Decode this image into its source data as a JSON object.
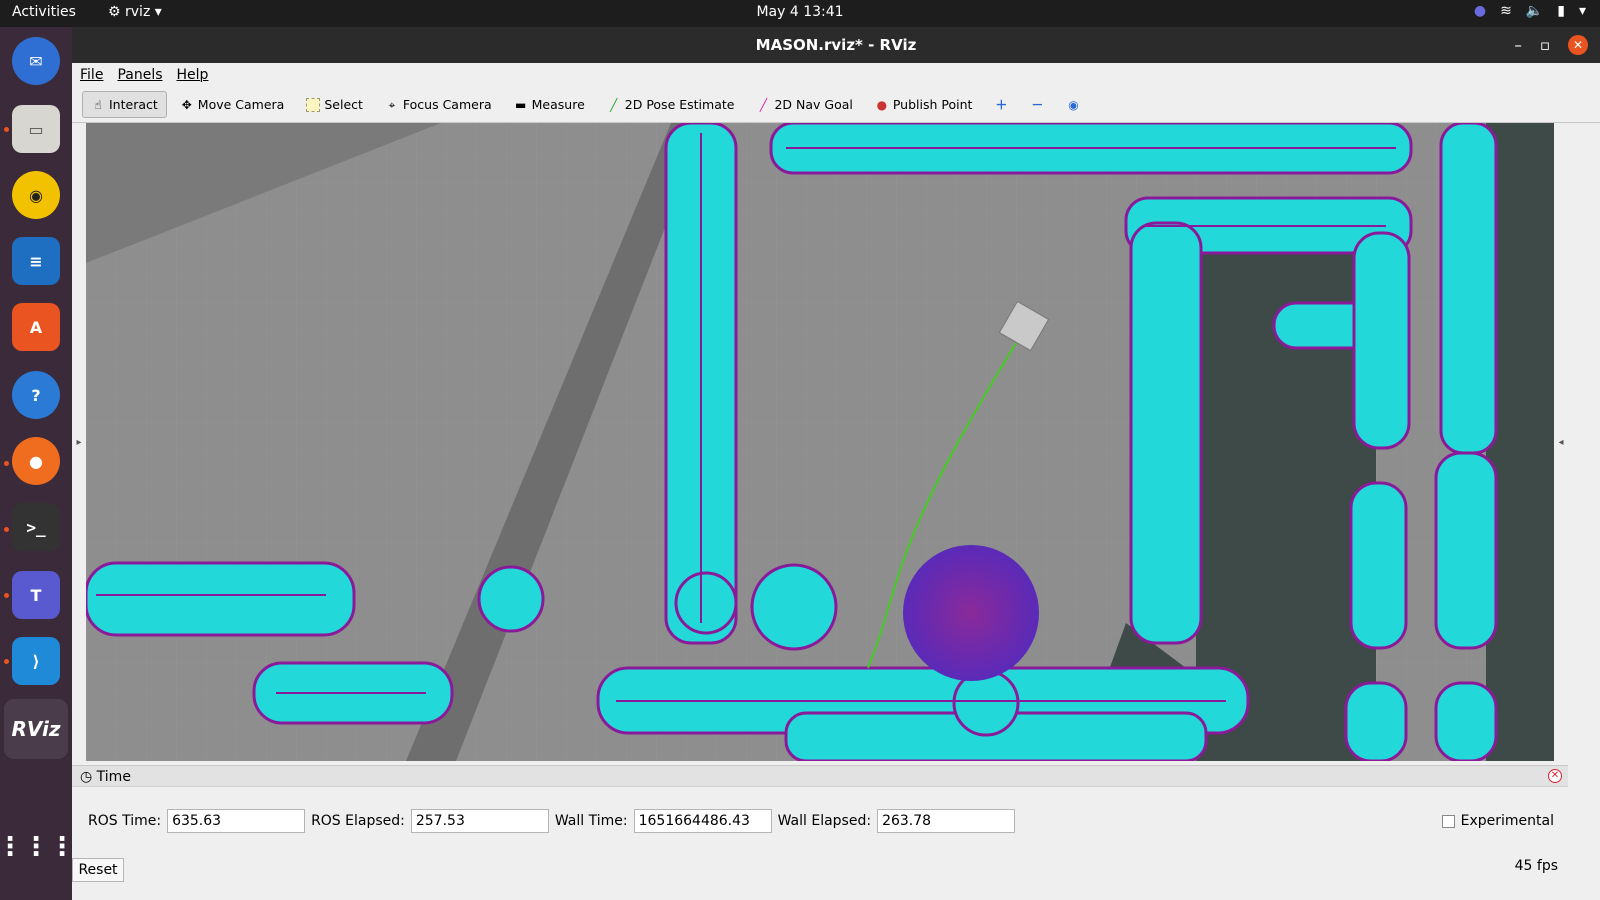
{
  "topbar": {
    "activities": "Activities",
    "app_name": "rviz",
    "clock": "May 4  13:41"
  },
  "dock": {
    "items": [
      "thunderbird",
      "files",
      "rhythmbox",
      "libreoffice-writer",
      "ubuntu-software",
      "help",
      "firefox",
      "terminal",
      "teams",
      "vscode",
      "rviz",
      "show-apps"
    ],
    "rviz_label": "RViz"
  },
  "window": {
    "title": "MASON.rviz* - RViz"
  },
  "menu": {
    "file": "File",
    "panels": "Panels",
    "help": "Help"
  },
  "toolbar": {
    "interact": "Interact",
    "move_camera": "Move Camera",
    "select": "Select",
    "focus_camera": "Focus Camera",
    "measure": "Measure",
    "pose_estimate": "2D Pose Estimate",
    "nav_goal": "2D Nav Goal",
    "publish_point": "Publish Point"
  },
  "time_panel": {
    "title": "Time",
    "ros_time_label": "ROS Time:",
    "ros_time": "635.63",
    "ros_elapsed_label": "ROS Elapsed:",
    "ros_elapsed": "257.53",
    "wall_time_label": "Wall Time:",
    "wall_time": "1651664486.43",
    "wall_elapsed_label": "Wall Elapsed:",
    "wall_elapsed": "263.78",
    "experimental": "Experimental",
    "reset": "Reset",
    "fps": "45 fps"
  },
  "colors": {
    "map_free": "#8e8e8e",
    "map_unknown": "#3d4a48",
    "costmap_inflation": "#22d8d8",
    "costmap_lethal": "#8a1a9a",
    "path": "#44cc22",
    "robot_marker": "#c9c9c9",
    "goal_blob": "#6a2aa8"
  }
}
